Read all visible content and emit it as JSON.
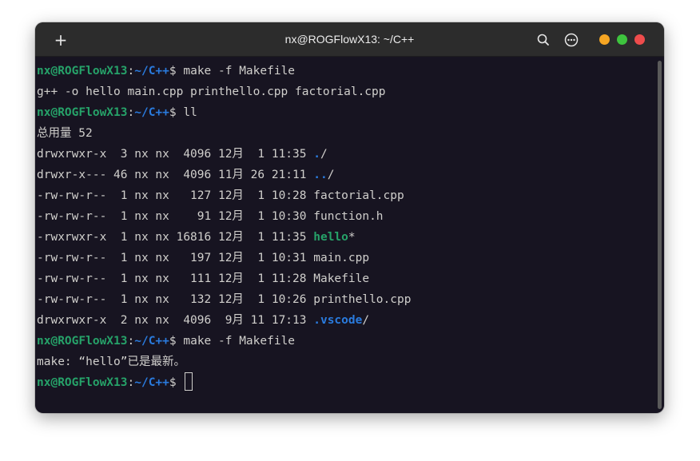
{
  "window": {
    "title": "nx@ROGFlowX13: ~/C++",
    "colors": {
      "background": "#171421",
      "titlebar": "#2c2c2c",
      "prompt_user": "#26a269",
      "prompt_path": "#2a7bde",
      "minimize": "#f6a623",
      "maximize": "#3ec43e",
      "close": "#ee4c4c"
    },
    "icons": {
      "new_tab": "plus-icon",
      "search": "search-icon",
      "menu": "ellipsis-menu-icon",
      "minimize": "minimize-dot-icon",
      "maximize": "maximize-dot-icon",
      "close": "close-dot-icon"
    }
  },
  "prompt": {
    "user": "nx@ROGFlowX13",
    "sep": ":",
    "path": "~/C++",
    "symbol": "$ "
  },
  "commands": {
    "c1": "make -f Makefile",
    "c2": "ll",
    "c3": "make -f Makefile"
  },
  "output": {
    "compile": "g++ -o hello main.cpp printhello.cpp factorial.cpp",
    "total": "总用量 52",
    "make_result": "make: “hello”已是最新。"
  },
  "listing": [
    {
      "meta": "drwxrwxr-x  3 nx nx  4096 12月  1 11:35 ",
      "name": ".",
      "suffix": "/"
    },
    {
      "meta": "drwxr-x--- 46 nx nx  4096 11月 26 21:11 ",
      "name": "..",
      "suffix": "/"
    },
    {
      "meta": "-rw-rw-r--  1 nx nx   127 12月  1 10:28 ",
      "name": "factorial.cpp",
      "suffix": ""
    },
    {
      "meta": "-rw-rw-r--  1 nx nx    91 12月  1 10:30 ",
      "name": "function.h",
      "suffix": ""
    },
    {
      "meta": "-rwxrwxr-x  1 nx nx 16816 12月  1 11:35 ",
      "name": "hello",
      "suffix": "*"
    },
    {
      "meta": "-rw-rw-r--  1 nx nx   197 12月  1 10:31 ",
      "name": "main.cpp",
      "suffix": ""
    },
    {
      "meta": "-rw-rw-r--  1 nx nx   111 12月  1 11:28 ",
      "name": "Makefile",
      "suffix": ""
    },
    {
      "meta": "-rw-rw-r--  1 nx nx   132 12月  1 10:26 ",
      "name": "printhello.cpp",
      "suffix": ""
    },
    {
      "meta": "drwxrwxr-x  2 nx nx  4096  9月 11 17:13 ",
      "name": ".vscode",
      "suffix": "/"
    }
  ]
}
